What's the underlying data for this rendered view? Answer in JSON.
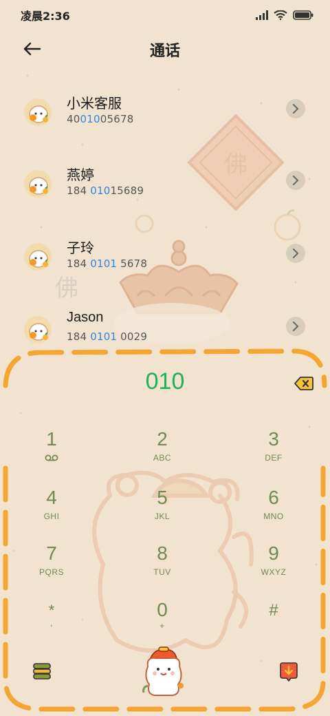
{
  "status_bar": {
    "time": "凌晨2:36"
  },
  "header": {
    "title": "通话"
  },
  "contacts": [
    {
      "name": "小米客服",
      "num_pre": "40",
      "num_hl": "010",
      "num_post": "05678"
    },
    {
      "name": "燕婷",
      "num_pre": "184 ",
      "num_hl": "010",
      "num_post": "15689"
    },
    {
      "name": "子玲",
      "num_pre": "184 ",
      "num_hl": "0101",
      "num_post": " 5678"
    },
    {
      "name": "Jason",
      "num_pre": "184 ",
      "num_hl": "0101",
      "num_post": " 0029"
    }
  ],
  "dialer": {
    "input": "010",
    "keys": [
      {
        "digit": "1",
        "letters": ""
      },
      {
        "digit": "2",
        "letters": "ABC"
      },
      {
        "digit": "3",
        "letters": "DEF"
      },
      {
        "digit": "4",
        "letters": "GHI"
      },
      {
        "digit": "5",
        "letters": "JKL"
      },
      {
        "digit": "6",
        "letters": "MNO"
      },
      {
        "digit": "7",
        "letters": "PQRS"
      },
      {
        "digit": "8",
        "letters": "TUV"
      },
      {
        "digit": "9",
        "letters": "WXYZ"
      },
      {
        "digit": "*",
        "letters": ","
      },
      {
        "digit": "0",
        "letters": "+"
      },
      {
        "digit": "#",
        "letters": ""
      }
    ]
  },
  "icons": {
    "back": "back-arrow-icon",
    "delete": "backspace-icon",
    "voicemail": "voicemail-icon",
    "menu": "menu-icon",
    "call": "call-mascot-icon",
    "hide_keypad": "hide-keypad-icon"
  },
  "colors": {
    "background": "#f1e3d0",
    "digit_text": "#1fb25a",
    "match_highlight": "#2f86e3",
    "key_text": "#6f8a52",
    "frame_orange": "#f5a532"
  }
}
